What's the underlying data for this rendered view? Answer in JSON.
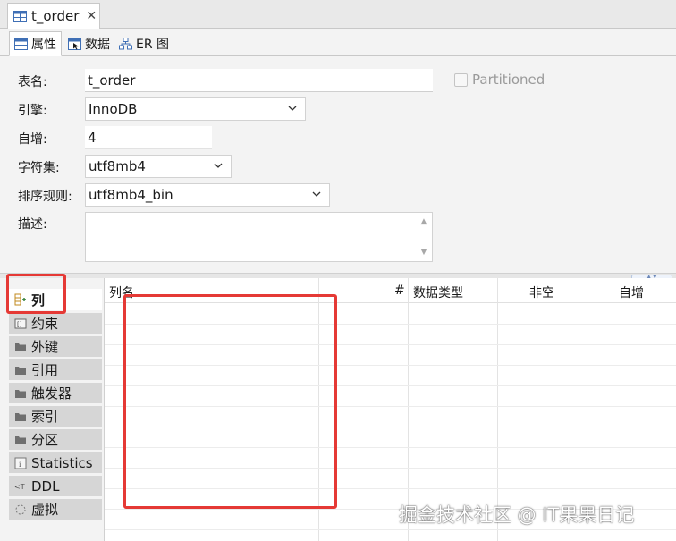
{
  "editor_tab": {
    "title": "t_order",
    "close_symbol": "✕"
  },
  "subtabs": [
    {
      "label": "属性",
      "icon": "table-properties-icon"
    },
    {
      "label": "数据",
      "icon": "table-data-icon"
    },
    {
      "label": "ER 图",
      "icon": "er-diagram-icon"
    }
  ],
  "form": {
    "table_name_label": "表名:",
    "table_name_value": "t_order",
    "partitioned_label": "Partitioned",
    "engine_label": "引擎:",
    "engine_value": "InnoDB",
    "auto_increment_label": "自增:",
    "auto_increment_value": "4",
    "charset_label": "字符集:",
    "charset_value": "utf8mb4",
    "collation_label": "排序规则:",
    "collation_value": "utf8mb4_bin",
    "description_label": "描述:",
    "description_value": ""
  },
  "side_nav": [
    {
      "label": "列",
      "icon": "columns-icon",
      "active": true
    },
    {
      "label": "约束",
      "icon": "constraint-icon"
    },
    {
      "label": "外键",
      "icon": "folder-icon"
    },
    {
      "label": "引用",
      "icon": "folder-icon"
    },
    {
      "label": "触发器",
      "icon": "folder-icon"
    },
    {
      "label": "索引",
      "icon": "folder-icon"
    },
    {
      "label": "分区",
      "icon": "folder-icon"
    },
    {
      "label": "Statistics",
      "icon": "info-icon"
    },
    {
      "label": "DDL",
      "icon": "ddl-icon"
    },
    {
      "label": "虚拟",
      "icon": "virtual-icon"
    }
  ],
  "columns_grid": {
    "headers": [
      "列名",
      "#",
      "数据类型",
      "非空",
      "自增"
    ],
    "rows": []
  },
  "colors": {
    "highlight": "#e53935",
    "accent": "#3f6fb5"
  },
  "watermark": "掘金技术社区 @ IT果果日记"
}
